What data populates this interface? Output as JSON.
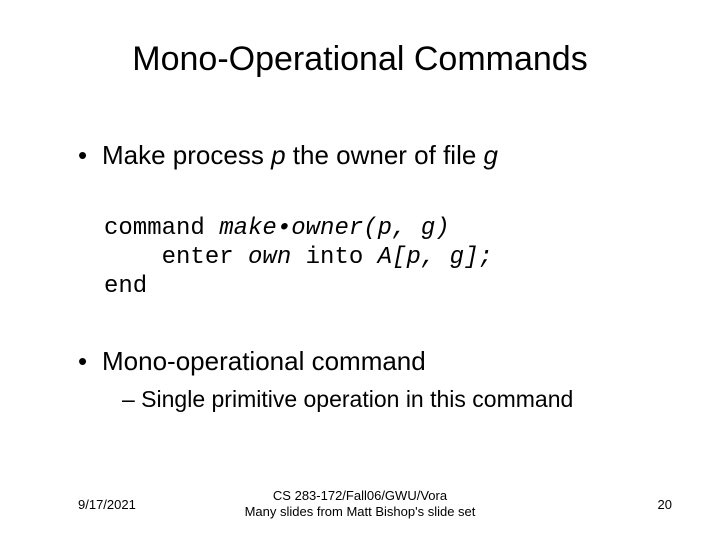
{
  "title": "Mono-Operational Commands",
  "bullet1": {
    "pre": "Make process ",
    "var1": "p",
    "mid": " the owner of file ",
    "var2": "g"
  },
  "code": {
    "l1a": "command ",
    "l1b": "make•owner(p, g)",
    "l2a": "    enter ",
    "l2b": "own",
    "l2c": " into ",
    "l2d": "A[p, g];",
    "l3": "end"
  },
  "bullet2": "Mono-operational command",
  "sub": "– Single primitive operation in this command",
  "footer": {
    "date": "9/17/2021",
    "center1": "CS 283-172/Fall06/GWU/Vora",
    "center2": "Many slides from Matt Bishop's slide set",
    "page": "20"
  }
}
